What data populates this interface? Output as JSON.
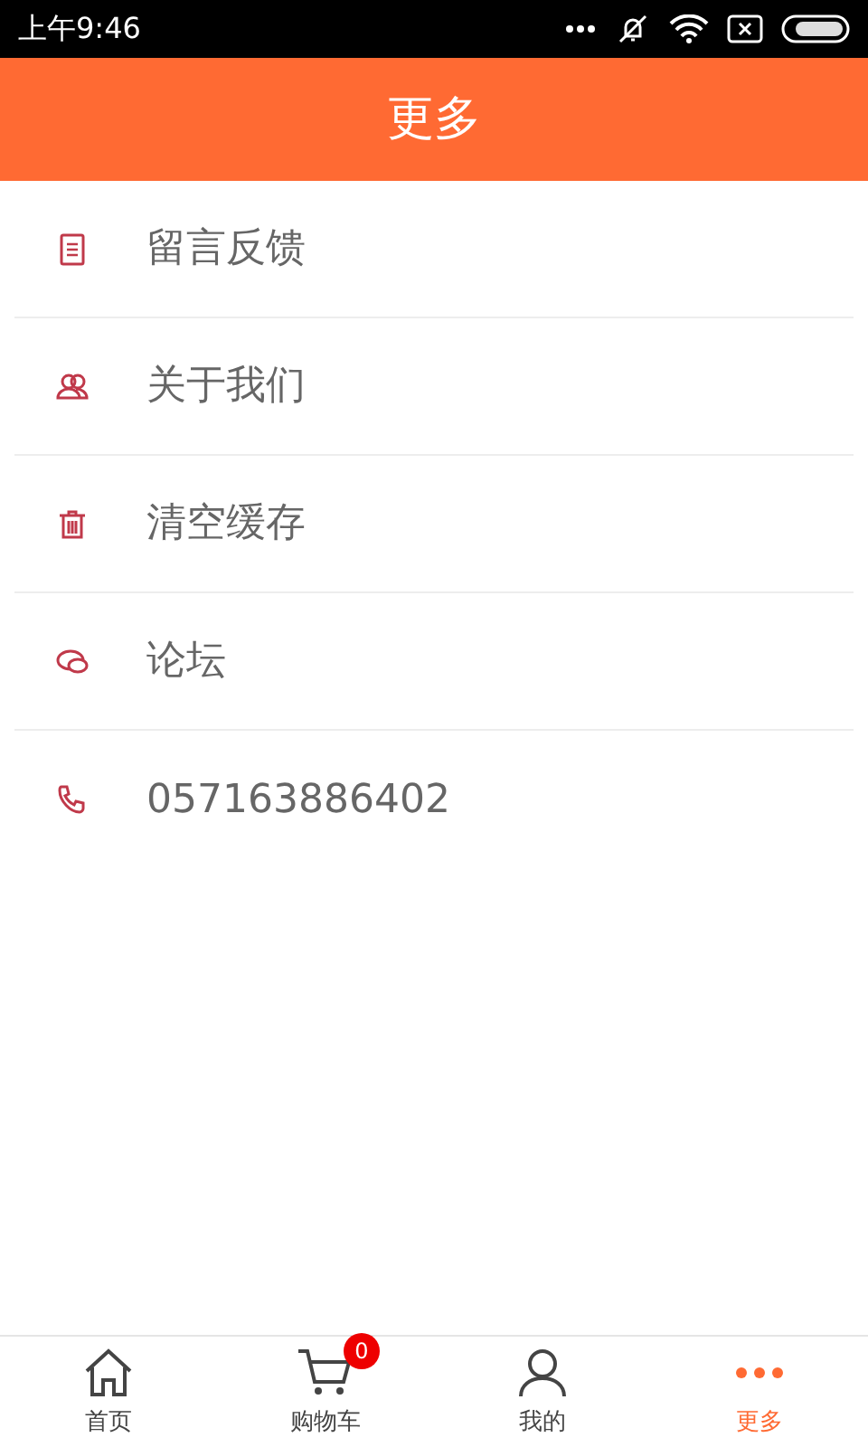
{
  "status_bar": {
    "time": "上午9:46"
  },
  "header": {
    "title": "更多"
  },
  "menu": [
    {
      "kind": "feedback",
      "label": "留言反馈"
    },
    {
      "kind": "about",
      "label": "关于我们"
    },
    {
      "kind": "trash",
      "label": "清空缓存"
    },
    {
      "kind": "forum",
      "label": "论坛"
    },
    {
      "kind": "phone",
      "label": "057163886402"
    }
  ],
  "tabs": [
    {
      "kind": "home",
      "label": "首页",
      "selected": false
    },
    {
      "kind": "cart",
      "label": "购物车",
      "selected": false,
      "badge": "0"
    },
    {
      "kind": "user",
      "label": "我的",
      "selected": false
    },
    {
      "kind": "more",
      "label": "更多",
      "selected": true
    }
  ]
}
